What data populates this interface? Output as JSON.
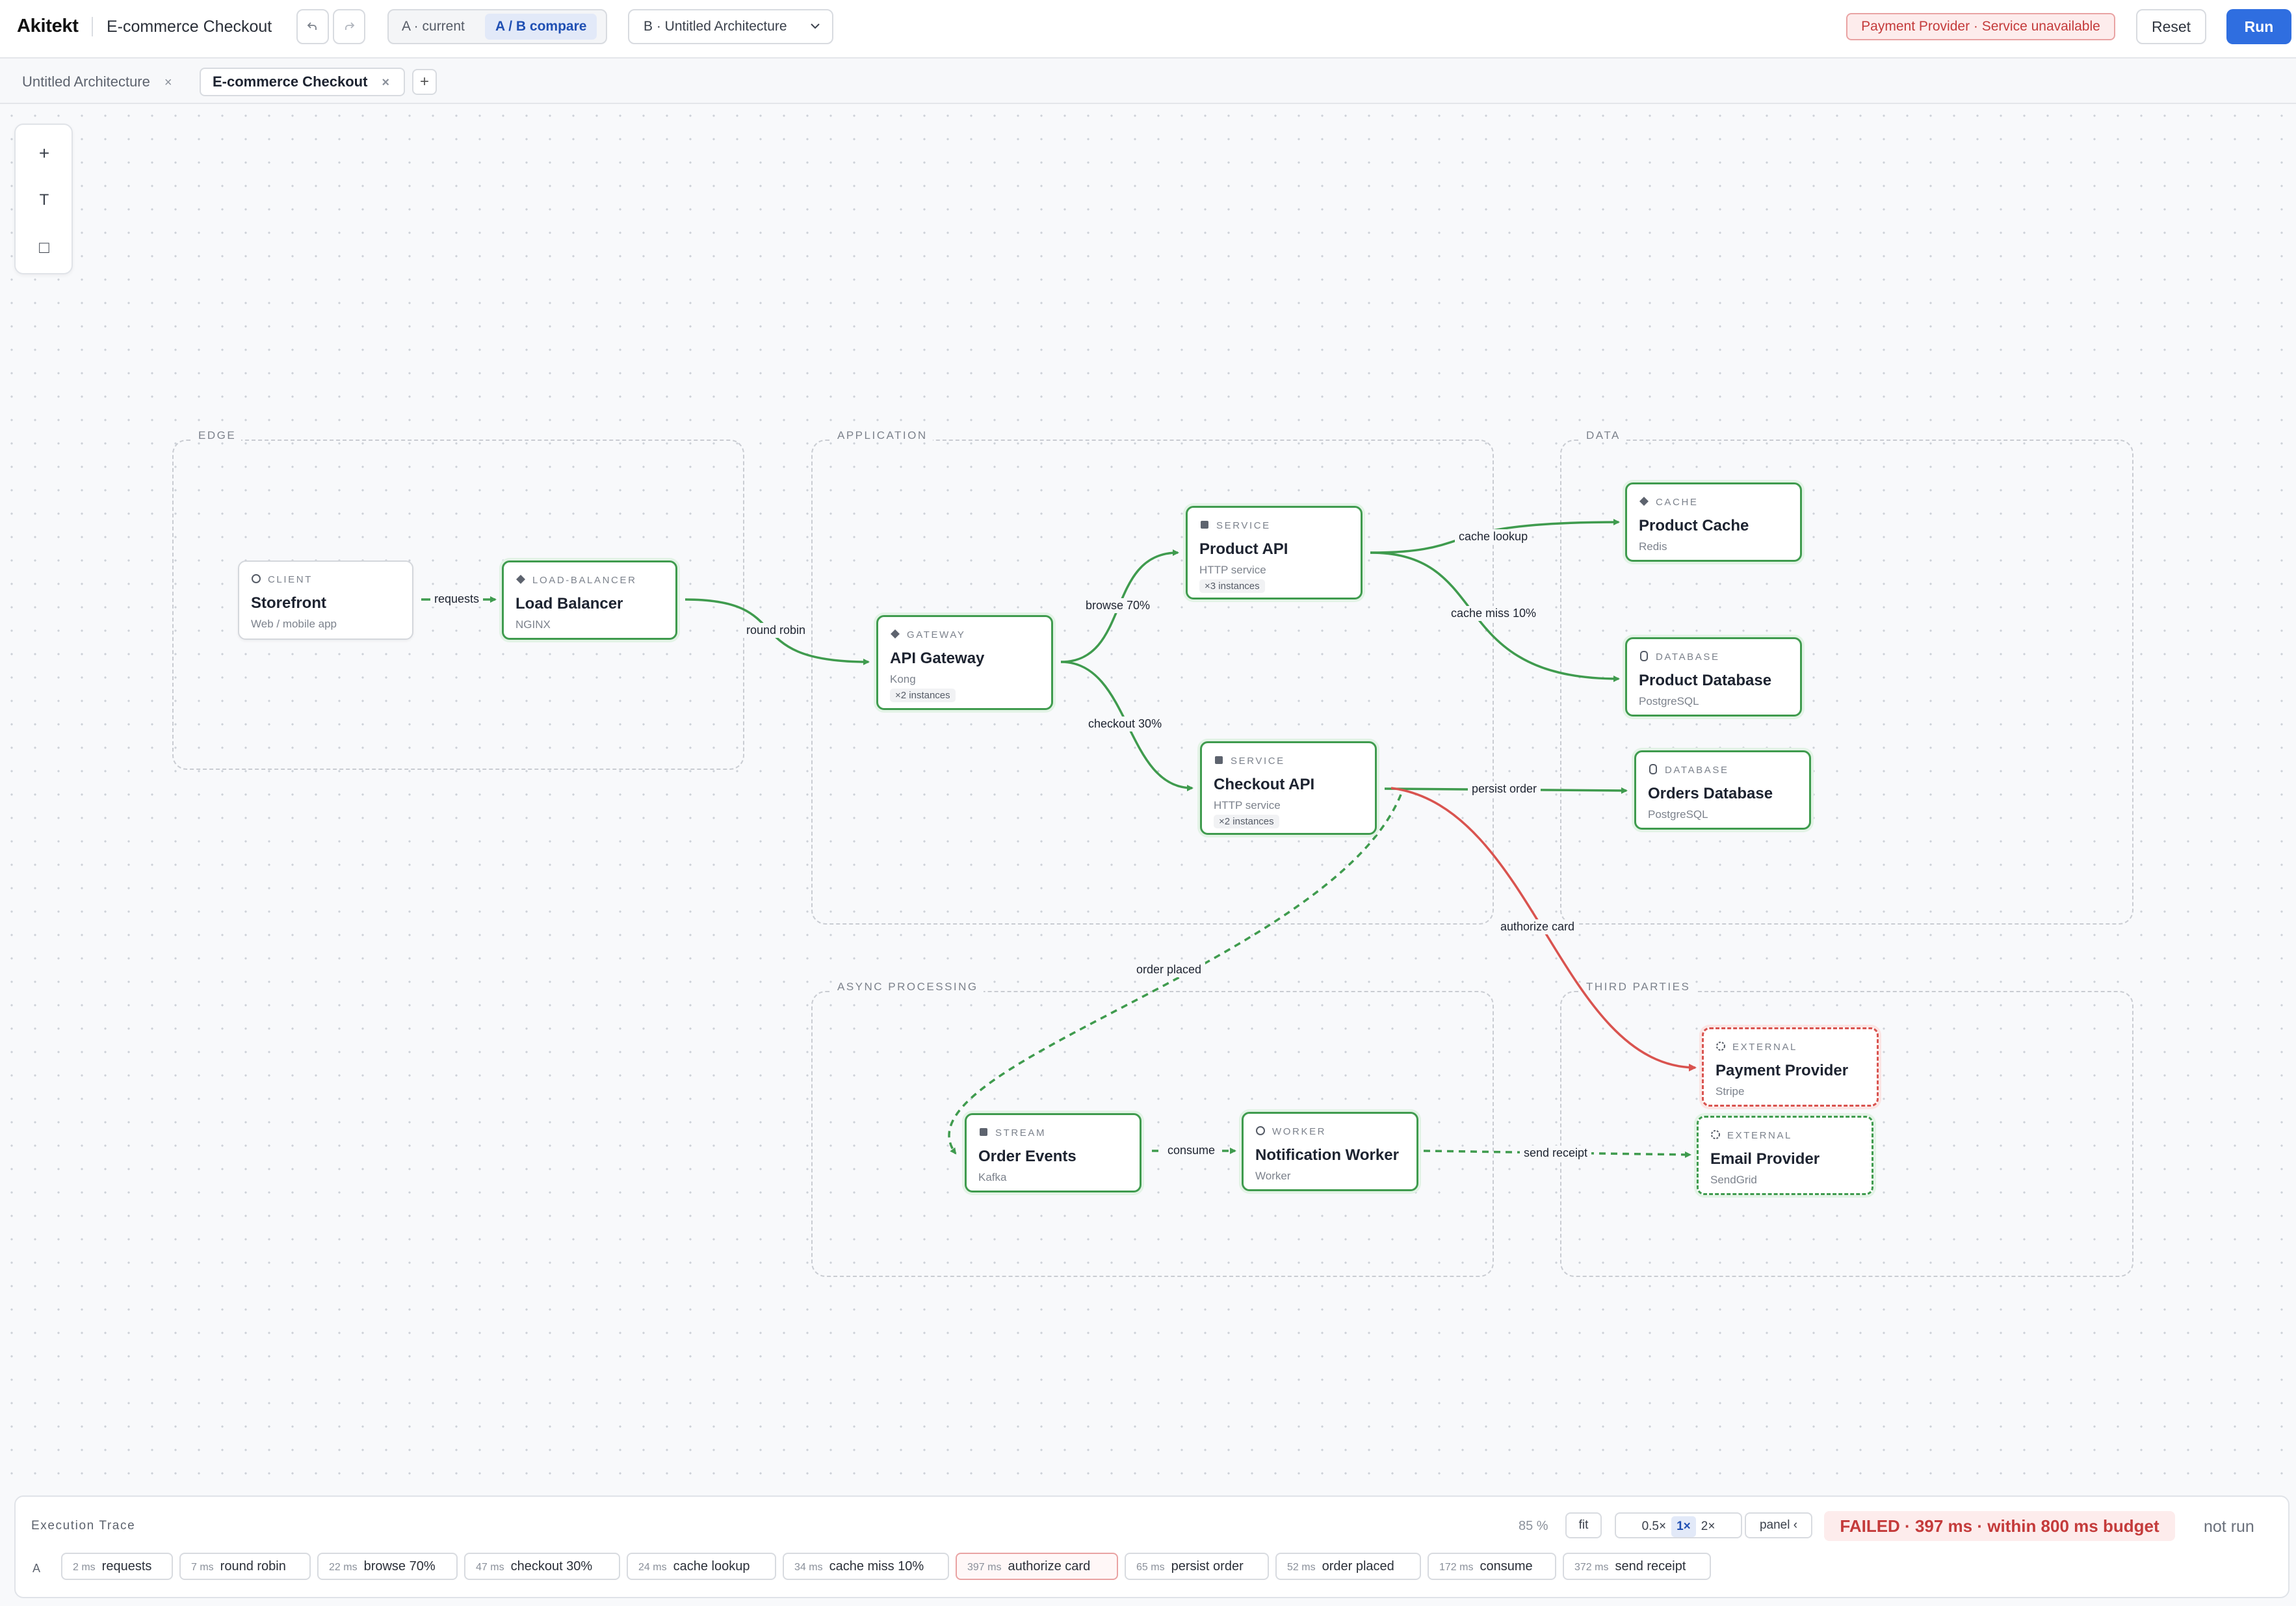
{
  "header": {
    "brand": "Akitekt",
    "doc_title": "E-commerce Checkout",
    "undo_icon": "undo-icon",
    "redo_icon": "redo-icon",
    "compare": {
      "a_label": "A · current",
      "ab_label": "A / B compare"
    },
    "b_select": "B · Untitled Architecture",
    "status_pill": "Payment Provider · Service unavailable",
    "reset_label": "Reset",
    "run_label": "Run"
  },
  "tabs": [
    {
      "label": "Untitled Architecture",
      "close": "×"
    },
    {
      "label": "E-commerce Checkout",
      "close": "×"
    }
  ],
  "tab_add": "+",
  "toolbox": {
    "add": "+",
    "text": "T",
    "rect": "□"
  },
  "groups": {
    "edge": "EDGE",
    "application": "APPLICATION",
    "data": "DATA",
    "async": "ASYNC PROCESSING",
    "third": "THIRD PARTIES"
  },
  "nodes": {
    "storefront": {
      "kind": "CLIENT",
      "name": "Storefront",
      "sub": "Web / mobile app"
    },
    "lb": {
      "kind": "LOAD-BALANCER",
      "name": "Load Balancer",
      "sub": "NGINX"
    },
    "gateway": {
      "kind": "GATEWAY",
      "name": "API Gateway",
      "sub": "Kong",
      "inst": "×2 instances"
    },
    "product_api": {
      "kind": "SERVICE",
      "name": "Product API",
      "sub": "HTTP service",
      "inst": "×3 instances"
    },
    "checkout_api": {
      "kind": "SERVICE",
      "name": "Checkout API",
      "sub": "HTTP service",
      "inst": "×2 instances"
    },
    "product_cache": {
      "kind": "CACHE",
      "name": "Product Cache",
      "sub": "Redis"
    },
    "product_db": {
      "kind": "DATABASE",
      "name": "Product Database",
      "sub": "PostgreSQL"
    },
    "orders_db": {
      "kind": "DATABASE",
      "name": "Orders Database",
      "sub": "PostgreSQL"
    },
    "order_events": {
      "kind": "STREAM",
      "name": "Order Events",
      "sub": "Kafka"
    },
    "notif_worker": {
      "kind": "WORKER",
      "name": "Notification Worker",
      "sub": "Worker"
    },
    "payment": {
      "kind": "EXTERNAL",
      "name": "Payment Provider",
      "sub": "Stripe"
    },
    "email": {
      "kind": "EXTERNAL",
      "name": "Email Provider",
      "sub": "SendGrid"
    }
  },
  "edges": {
    "requests": "requests",
    "round_robin": "round robin",
    "browse": "browse 70%",
    "checkout": "checkout 30%",
    "cache_lookup": "cache lookup",
    "cache_miss": "cache miss 10%",
    "persist": "persist order",
    "authorize": "authorize card",
    "order_placed": "order placed",
    "consume": "consume",
    "send_receipt": "send receipt"
  },
  "colors": {
    "ok": "#3f9b4e",
    "fail": "#d9534f",
    "accent": "#2f6ee0"
  },
  "trace": {
    "title": "Execution Trace",
    "zoom": "85 %",
    "fit": "fit",
    "speeds": [
      "0.5×",
      "1×",
      "2×"
    ],
    "speed_selected": "1×",
    "panel": "panel ‹",
    "result": "FAILED · 397 ms · within 800 ms budget",
    "b_status": "not run",
    "row_label": "A",
    "steps": [
      {
        "ms": "2 ms",
        "label": "requests",
        "failed": false
      },
      {
        "ms": "7 ms",
        "label": "round robin",
        "failed": false
      },
      {
        "ms": "22 ms",
        "label": "browse 70%",
        "failed": false
      },
      {
        "ms": "47 ms",
        "label": "checkout 30%",
        "failed": false
      },
      {
        "ms": "24 ms",
        "label": "cache lookup",
        "failed": false
      },
      {
        "ms": "34 ms",
        "label": "cache miss 10%",
        "failed": false
      },
      {
        "ms": "397 ms",
        "label": "authorize card",
        "failed": true
      },
      {
        "ms": "65 ms",
        "label": "persist order",
        "failed": false
      },
      {
        "ms": "52 ms",
        "label": "order placed",
        "failed": false
      },
      {
        "ms": "172 ms",
        "label": "consume",
        "failed": false
      },
      {
        "ms": "372 ms",
        "label": "send receipt",
        "failed": false
      }
    ]
  }
}
